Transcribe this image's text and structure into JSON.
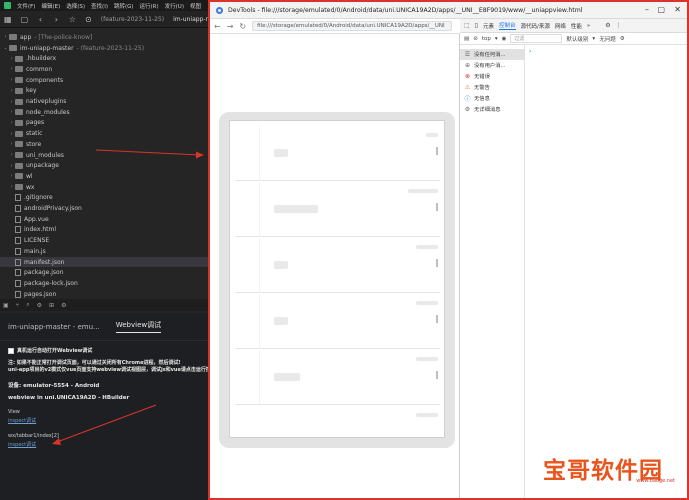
{
  "ide": {
    "menu": [
      "文件(F)",
      "编辑(E)",
      "选择(S)",
      "查找(I)",
      "跳转(G)",
      "运行(R)",
      "发行(U)",
      "视图"
    ],
    "toolbar_tabs": [
      "(feature-2023-11-25)",
      "im-uniapp-r"
    ],
    "tree": [
      {
        "label": "app",
        "suffix": "- [The-police-know]",
        "type": "folder",
        "arrow": "›"
      },
      {
        "label": "im-uniapp-master",
        "suffix": "- (feature-2023-11-25)",
        "type": "folder",
        "arrow": "⌄"
      },
      {
        "label": ".hbuilderx",
        "type": "folder",
        "arrow": "›"
      },
      {
        "label": "common",
        "type": "folder",
        "arrow": "›"
      },
      {
        "label": "components",
        "type": "folder",
        "arrow": "›"
      },
      {
        "label": "key",
        "type": "folder",
        "arrow": "›"
      },
      {
        "label": "nativeplugins",
        "type": "folder",
        "arrow": "›"
      },
      {
        "label": "node_modules",
        "type": "folder",
        "arrow": "›"
      },
      {
        "label": "pages",
        "type": "folder",
        "arrow": "›"
      },
      {
        "label": "static",
        "type": "folder",
        "arrow": "›"
      },
      {
        "label": "store",
        "type": "folder",
        "arrow": "›"
      },
      {
        "label": "uni_modules",
        "type": "folder",
        "arrow": "›"
      },
      {
        "label": "unpackage",
        "type": "folder",
        "arrow": "›"
      },
      {
        "label": "wl",
        "type": "folder",
        "arrow": "›"
      },
      {
        "label": "wx",
        "type": "folder",
        "arrow": "›"
      },
      {
        "label": ".gitignore",
        "type": "file"
      },
      {
        "label": "androidPrivacy.json",
        "type": "file"
      },
      {
        "label": "App.vue",
        "type": "file"
      },
      {
        "label": "index.html",
        "type": "file"
      },
      {
        "label": "LICENSE",
        "type": "file"
      },
      {
        "label": "main.js",
        "type": "file"
      },
      {
        "label": "manifest.json",
        "type": "file",
        "selected": true
      },
      {
        "label": "package.json",
        "type": "file"
      },
      {
        "label": "package-lock.json",
        "type": "file"
      },
      {
        "label": "pages.json",
        "type": "file"
      }
    ],
    "panel": {
      "tabs": [
        "im-uniapp-master - emu...",
        "Webview调试"
      ],
      "checkbox_label": "真机运行自动打开Webview调试",
      "note_line1": "注: 如果不能正常打开调试页面，可以通过关闭所有Chrome进程，然后调试!",
      "note_line2": "uni-app项目的v2模式仅vue页面支持webview调试视图层，调试js和vue请点击运行控制台的上",
      "device": "设备: emulator-5554 - Android",
      "webview_title": "webview in uni.UNICA19A2D - HBuilder",
      "view_label": "View",
      "inspect_link1": "inspect调试",
      "page_label": "wx/tabbar1/index[2]",
      "inspect_link2": "inspect调试"
    }
  },
  "devtools": {
    "title": "DevTools - file:///storage/emulated/0/Android/data/uni.UNICA19A2D/apps/__UNI__E8F9019/www/__uniappview.html",
    "url": "file:///storage/emulated/0/Android/data/uni.UNICA19A2D/apps/__UNI",
    "tabs": [
      "元素",
      "控制台",
      "源代码/来源",
      "网络",
      "性能"
    ],
    "active_tab": "控制台",
    "filter": {
      "context": "top",
      "placeholder": "过滤",
      "level": "默认级别",
      "issues": "无问题"
    },
    "sidebar": [
      {
        "label": "没有任何消...",
        "icon": "list-icon",
        "glyph": "☰",
        "kind": "msg"
      },
      {
        "label": "没有用户消...",
        "icon": "user-icon",
        "glyph": "⊕",
        "kind": "msg"
      },
      {
        "label": "无错误",
        "icon": "error-icon",
        "glyph": "⊗",
        "kind": "err"
      },
      {
        "label": "无警告",
        "icon": "warning-icon",
        "glyph": "⚠",
        "kind": "warn"
      },
      {
        "label": "无信息",
        "icon": "info-icon",
        "glyph": "ⓘ",
        "kind": "info"
      },
      {
        "label": "无详细消息",
        "icon": "verbose-icon",
        "glyph": "⚙",
        "kind": "ver"
      }
    ],
    "prompt": "›"
  },
  "watermark": {
    "text": "宝哥软件园"
  },
  "colors": {
    "accent": "#1a73e8",
    "annotation_red": "#d9342b",
    "watermark_orange": "#e8541c"
  }
}
